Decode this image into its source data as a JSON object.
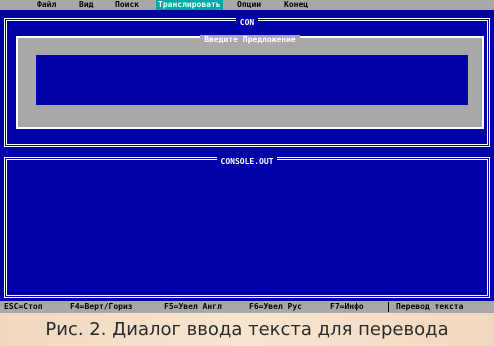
{
  "menu": {
    "items": [
      {
        "label": "Файл"
      },
      {
        "label": "Вид"
      },
      {
        "label": "Поиск"
      },
      {
        "label": "Транслировать",
        "active": true
      },
      {
        "label": "Опции"
      },
      {
        "label": "Конец"
      }
    ]
  },
  "top_panel": {
    "title": "CON"
  },
  "dialog": {
    "title": "Введите Предложение",
    "input_value": ""
  },
  "bottom_panel": {
    "title": "CONSOLE.OUT"
  },
  "statusbar": {
    "items": [
      {
        "label": "ESC=Стоп"
      },
      {
        "label": "F4=Верт/Гориз"
      },
      {
        "label": "F5=Увел Англ"
      },
      {
        "label": "F6=Увел Рус"
      },
      {
        "label": "F7=Инфо"
      },
      {
        "label": "Перевод текста"
      }
    ]
  },
  "caption": "Рис. 2. Диалог ввода текста для перевода",
  "colors": {
    "background": "#0000a8",
    "menubar": "#a8a8a8",
    "highlight": "#00a8a8"
  }
}
